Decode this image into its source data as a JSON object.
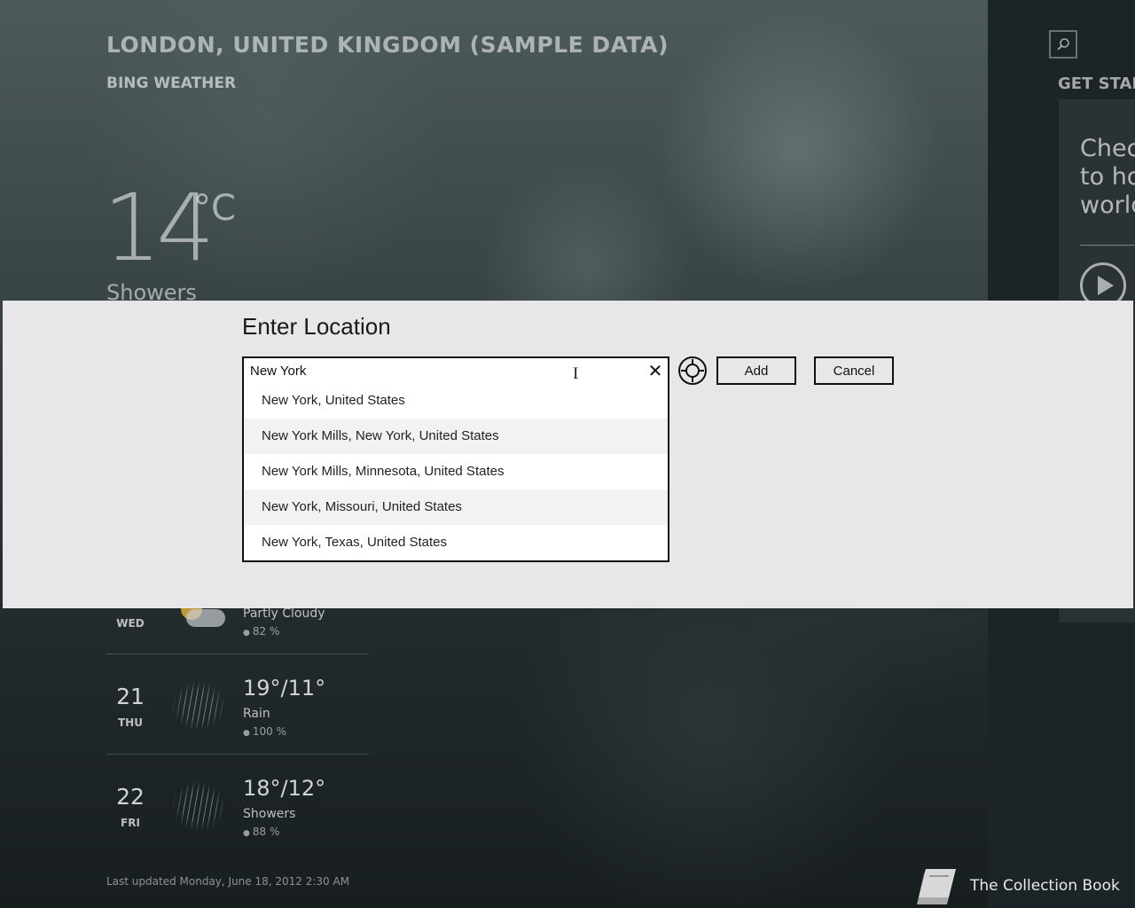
{
  "background": {
    "city_title": "LONDON, UNITED KINGDOM (SAMPLE DATA)",
    "app_name": "BING WEATHER",
    "temperature": "14",
    "temperature_unit": "°C",
    "condition": "Showers",
    "get_started": {
      "title": "GET STARTED",
      "text": "Check\nto ho\nworld"
    },
    "forecast": [
      {
        "day_num": "",
        "dow": "WED",
        "temps": "",
        "desc": "Partly Cloudy",
        "precip": "82 %"
      },
      {
        "day_num": "21",
        "dow": "THU",
        "temps": "19°/11°",
        "desc": "Rain",
        "precip": "100 %"
      },
      {
        "day_num": "22",
        "dow": "FRI",
        "temps": "18°/12°",
        "desc": "Showers",
        "precip": "88 %"
      }
    ],
    "last_updated": "Last updated Monday, June 18, 2012 2:30 AM",
    "collection_book": "The Collection Book"
  },
  "dialog": {
    "title": "Enter Location",
    "input_value": "New York",
    "add_label": "Add",
    "cancel_label": "Cancel",
    "suggestions": [
      "New York, United States",
      "New York Mills, New York, United States",
      "New York Mills, Minnesota, United States",
      "New York, Missouri, United States",
      "New York, Texas, United States"
    ]
  },
  "icons": {
    "search": "search-icon",
    "clear": "close-icon",
    "locate": "locate-me-icon",
    "book": "book-icon",
    "play": "play-icon",
    "weather": [
      "partly-cloudy-icon",
      "rain-icon",
      "showers-icon"
    ]
  }
}
